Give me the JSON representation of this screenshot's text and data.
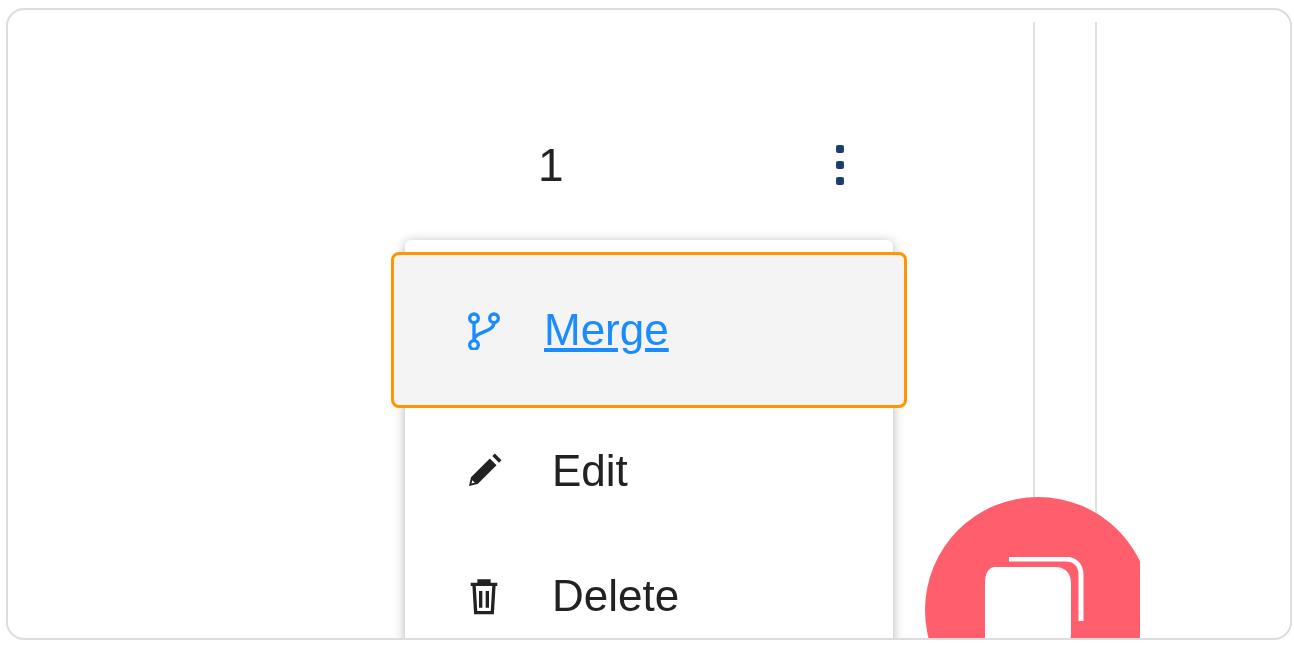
{
  "count": "1",
  "menu": {
    "items": [
      {
        "label": "Merge",
        "selected": true
      },
      {
        "label": "Edit",
        "selected": false
      },
      {
        "label": "Delete",
        "selected": false
      }
    ]
  }
}
